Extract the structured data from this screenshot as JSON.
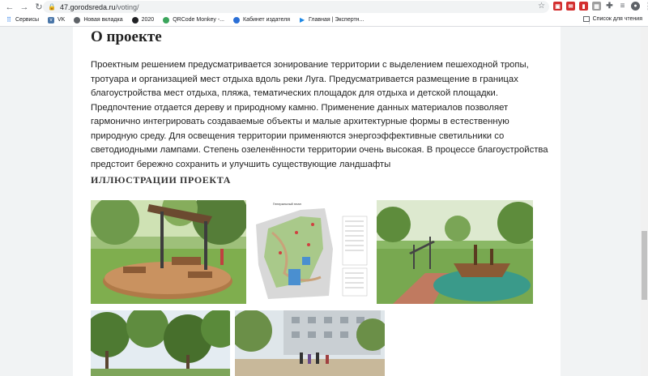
{
  "browser": {
    "url_domain": "47.gorodsreda.ru",
    "url_path": "/voting/",
    "back_icon": "arrow-left",
    "forward_icon": "arrow-right",
    "reload_icon": "reload",
    "bookmark_star_icon": "star"
  },
  "bookmarks": {
    "items": [
      {
        "label": "Сервисы",
        "icon": "apps-icon"
      },
      {
        "label": "VK",
        "icon": "vk-icon"
      },
      {
        "label": "Новая вкладка",
        "icon": "globe-icon"
      },
      {
        "label": "2020",
        "icon": "ball-icon"
      },
      {
        "label": "QRCode Monkey -...",
        "icon": "qr-icon"
      },
      {
        "label": "Кабинет издателя",
        "icon": "yandex-icon"
      },
      {
        "label": "Главная | Экспертн...",
        "icon": "play-icon"
      }
    ],
    "reading_list": "Список для чтения"
  },
  "content": {
    "title": "О проекте",
    "paragraph": "Проектным решением предусматривается зонирование территории с выделением пешеходной тропы, тротуара и организацией мест отдыха вдоль реки Луга. Предусматривается размещение в границах благоустройства мест отдыха, пляжа, тематических площадок для отдыха и детской площадки. Предпочтение отдается дереву и природному камню. Применение данных материалов позволяет гармонично интегрировать создаваемые объекты и малые архитектурные формы в естественную природную среду. Для освещения территории применяются энергоэффективные светильники со светодиодными лампами. Степень озеленённости территории очень высокая. В процессе благоустройства предстоит бережно сохранить и улучшить существующие ландшафты",
    "section_title": "ИЛЛЮСТРАЦИИ ПРОЕКТА",
    "plan_caption": "Генеральный план"
  },
  "colors": {
    "accent": "#1a73e8",
    "page_bg": "#ffffff",
    "outer_bg": "#f1f3f4"
  }
}
